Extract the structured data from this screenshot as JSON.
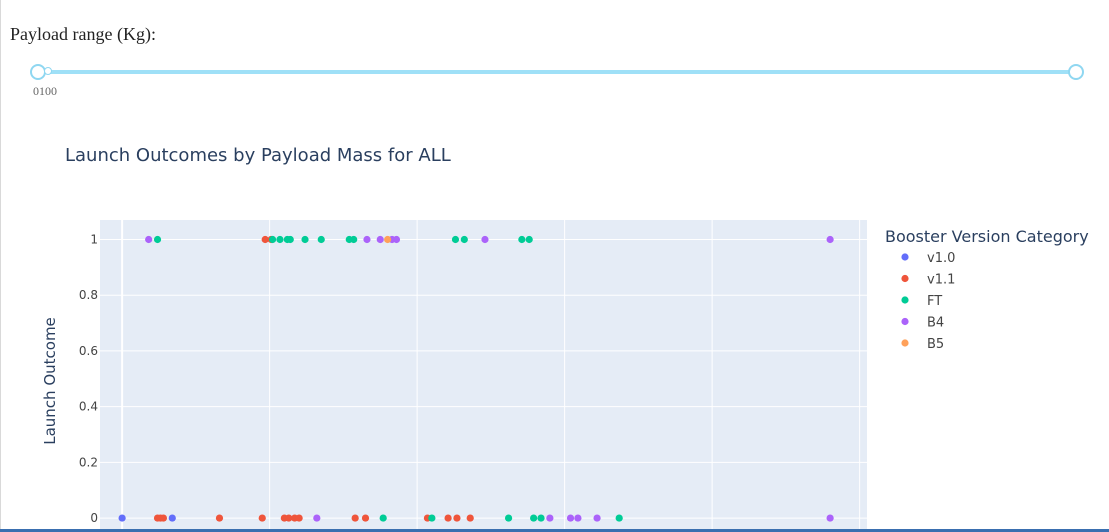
{
  "slider": {
    "label": "Payload range (Kg):",
    "marks_text": "0100",
    "accent_color": "#9fe0f7"
  },
  "chart_data": {
    "type": "scatter",
    "title": "Launch Outcomes by Payload Mass for ALL",
    "xlabel": "",
    "ylabel": "Launch Outcome",
    "ylim": [
      -0.05,
      1.07
    ],
    "xlim": [
      -0.15,
      5.05
    ],
    "y_ticks": [
      0,
      0.2,
      0.4,
      0.6,
      0.8,
      1
    ],
    "y_tick_labels": [
      "0",
      "0.2",
      "0.4",
      "0.6",
      "0.8",
      "1"
    ],
    "legend_title": "Booster Version Category",
    "series": [
      {
        "name": "v1.0",
        "color": "#636efa",
        "points": [
          [
            0,
            0
          ],
          [
            0.34,
            0
          ]
        ]
      },
      {
        "name": "v1.1",
        "color": "#ef553b",
        "points": [
          [
            0.24,
            0
          ],
          [
            0.26,
            0
          ],
          [
            0.28,
            0
          ],
          [
            0.66,
            0
          ],
          [
            0.95,
            0
          ],
          [
            0.97,
            1
          ],
          [
            1.01,
            1
          ],
          [
            1.1,
            0
          ],
          [
            1.13,
            0
          ],
          [
            1.17,
            0
          ],
          [
            1.2,
            0
          ],
          [
            1.58,
            0
          ],
          [
            1.65,
            0
          ],
          [
            2.07,
            0
          ],
          [
            2.21,
            0
          ],
          [
            2.27,
            0
          ],
          [
            2.36,
            0
          ]
        ]
      },
      {
        "name": "FT",
        "color": "#00cc96",
        "points": [
          [
            0.24,
            1
          ],
          [
            1.02,
            1
          ],
          [
            1.07,
            1
          ],
          [
            1.12,
            1
          ],
          [
            1.14,
            1
          ],
          [
            1.24,
            1
          ],
          [
            1.35,
            1
          ],
          [
            1.54,
            1
          ],
          [
            1.57,
            1
          ],
          [
            1.77,
            0
          ],
          [
            2.1,
            0
          ],
          [
            2.26,
            1
          ],
          [
            2.32,
            1
          ],
          [
            2.62,
            0
          ],
          [
            2.71,
            1
          ],
          [
            2.76,
            1
          ],
          [
            2.79,
            0
          ],
          [
            2.84,
            0
          ],
          [
            3.37,
            0
          ]
        ]
      },
      {
        "name": "B4",
        "color": "#ab63fa",
        "points": [
          [
            0.18,
            1
          ],
          [
            1.32,
            0
          ],
          [
            1.66,
            1
          ],
          [
            1.75,
            1
          ],
          [
            1.83,
            1
          ],
          [
            1.86,
            1
          ],
          [
            2.46,
            1
          ],
          [
            2.9,
            0
          ],
          [
            3.04,
            0
          ],
          [
            3.09,
            0
          ],
          [
            3.22,
            0
          ],
          [
            4.8,
            1
          ],
          [
            4.8,
            0
          ]
        ]
      },
      {
        "name": "B5",
        "color": "#ffa15a",
        "points": [
          [
            1.8,
            1
          ]
        ]
      }
    ]
  }
}
